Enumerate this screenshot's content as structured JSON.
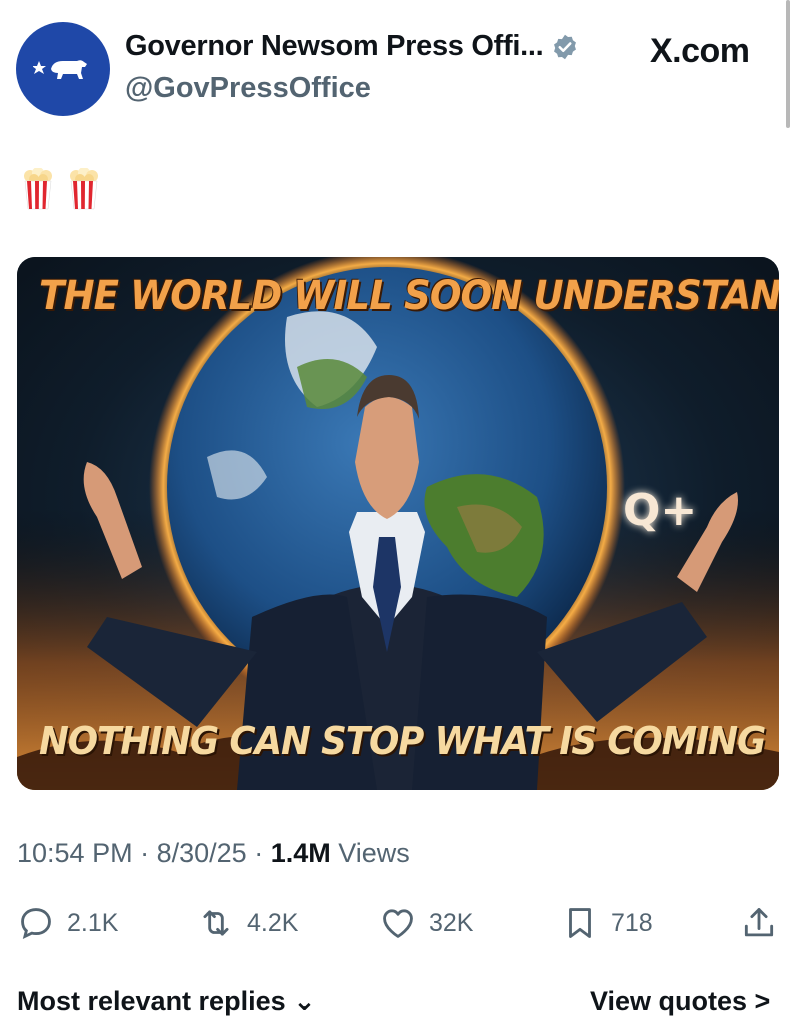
{
  "header": {
    "display_name": "Governor Newsom Press Offi...",
    "handle": "@GovPressOffice",
    "site_label": "X.com"
  },
  "post": {
    "emoji_text": "🍿🍿",
    "image": {
      "caption_top": "THE WORLD WILL SOON UNDERSTAND",
      "caption_bottom": "NOTHING CAN STOP WHAT IS COMING",
      "overlay_text": "Q+"
    },
    "time": "10:54 PM",
    "date": "8/30/25",
    "views_count": "1.4M",
    "views_label": "Views"
  },
  "actions": {
    "replies": "2.1K",
    "reposts": "4.2K",
    "likes": "32K",
    "bookmarks": "718"
  },
  "footer": {
    "replies_sort": "Most relevant replies ⌄",
    "view_quotes": "View quotes >"
  },
  "colors": {
    "avatar_bg": "#1f48a8",
    "verified": "#829aab",
    "text_primary": "#0f1419",
    "text_secondary": "#536471"
  },
  "icons": [
    "bear-flag-icon",
    "verified-badge-icon",
    "popcorn-icon",
    "reply-icon",
    "repost-icon",
    "like-icon",
    "bookmark-icon",
    "share-icon"
  ]
}
